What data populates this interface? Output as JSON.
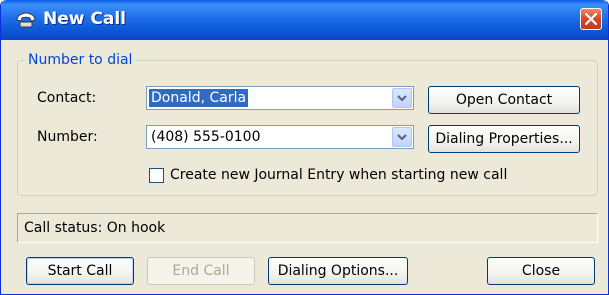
{
  "window": {
    "title": "New Call"
  },
  "group": {
    "legend": "Number to dial"
  },
  "contact": {
    "label": "Contact:",
    "value": "Donald, Carla"
  },
  "number": {
    "label": "Number:",
    "value": "(408) 555-0100"
  },
  "buttons": {
    "open_contact": "Open Contact",
    "dialing_properties": "Dialing Properties...",
    "start_call": "Start Call",
    "end_call": "End Call",
    "dialing_options": "Dialing Options...",
    "close": "Close"
  },
  "journal": {
    "label": "Create new Journal Entry when starting new call",
    "checked": false
  },
  "status": {
    "text": "Call status:  On hook"
  },
  "icons": {
    "title": "phone-icon",
    "close": "close-icon",
    "dropdown": "chevron-down-icon"
  },
  "colors": {
    "titlebar": "#0a55d6",
    "close_button": "#d6452a",
    "group_legend": "#0046d5",
    "selection": "#316ac5",
    "dialog_face": "#ece9d8"
  }
}
